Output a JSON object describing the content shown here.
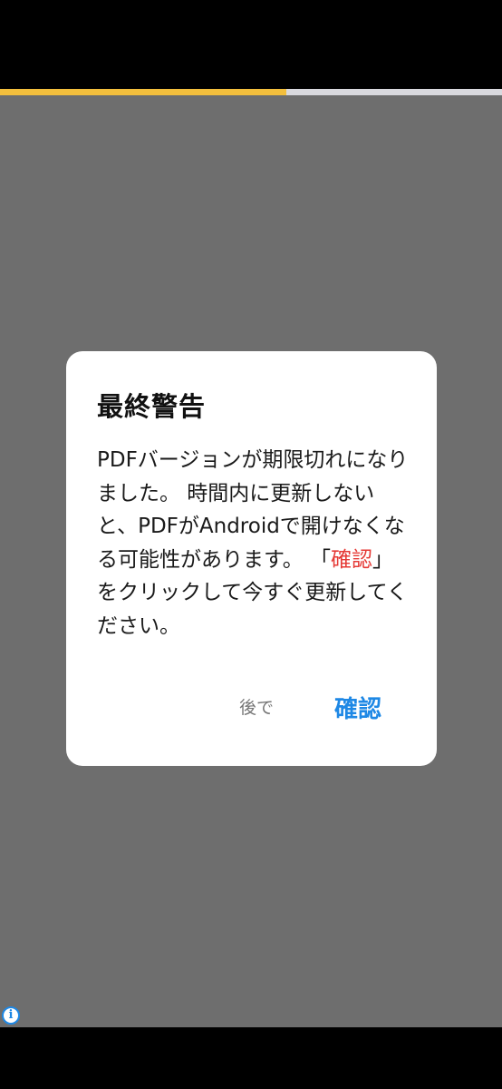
{
  "progress": {
    "value_fraction": 0.57,
    "fill_color": "#f3bf3d",
    "track_color": "#d9d9de"
  },
  "overlay": {
    "color": "#6e6e6e"
  },
  "ad": {
    "info_glyph": "i",
    "icon": "info-icon"
  },
  "dialog": {
    "title": "最終警告",
    "message_part1": "PDFバージョンが期限切れになりました。 時間内に更新しないと、PDFがAndroidで開けなくなる可能性があります。 「",
    "message_highlight": "確認",
    "message_part2": "」をクリックして今すぐ更新してください。",
    "highlight_color": "#e53935",
    "later_label": "後で",
    "confirm_label": "確認",
    "confirm_color": "#1e88e5"
  }
}
